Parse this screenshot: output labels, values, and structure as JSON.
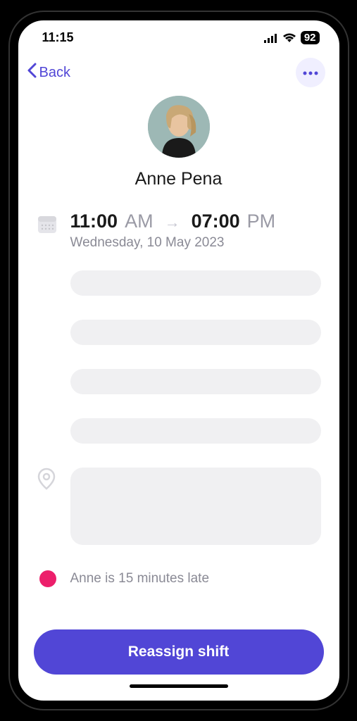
{
  "status_bar": {
    "time": "11:15",
    "battery": "92"
  },
  "nav": {
    "back_label": "Back"
  },
  "profile": {
    "name": "Anne Pena"
  },
  "shift": {
    "start_time": "11:00",
    "start_period": "AM",
    "end_time": "07:00",
    "end_period": "PM",
    "date": "Wednesday, 10 May 2023"
  },
  "status": {
    "text": "Anne is 15 minutes late",
    "color": "#ec1f6b"
  },
  "actions": {
    "primary_label": "Reassign shift"
  },
  "colors": {
    "accent": "#5146d6",
    "muted_text": "#8a8a95",
    "skeleton": "#f0f0f2"
  }
}
